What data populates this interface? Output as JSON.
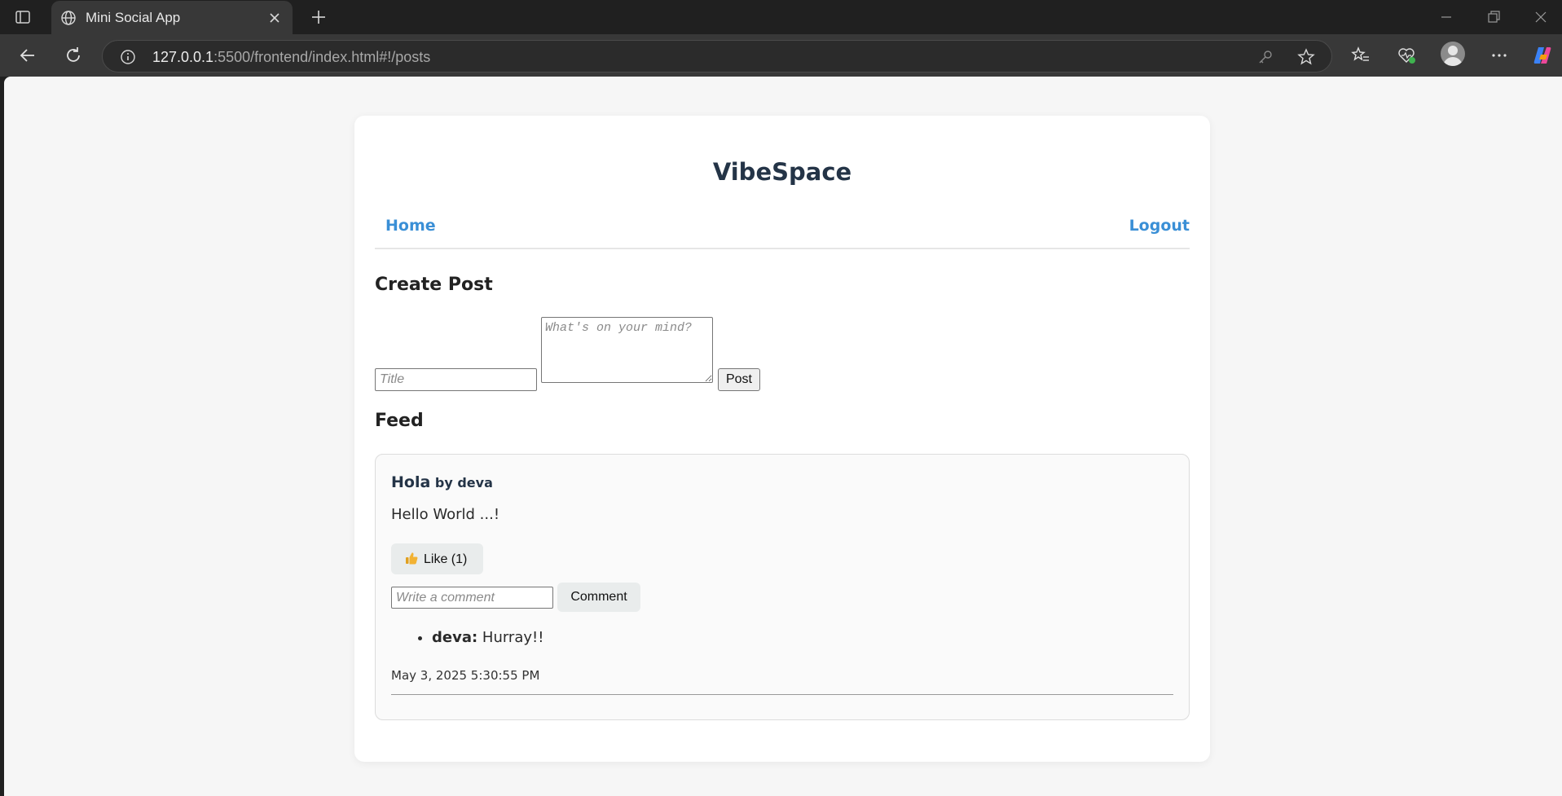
{
  "browser": {
    "tab_title": "Mini Social App",
    "url_host": "127.0.0.1",
    "url_rest": ":5500/frontend/index.html#!/posts"
  },
  "app": {
    "brand": "VibeSpace",
    "nav": {
      "home": "Home",
      "logout": "Logout"
    }
  },
  "create_post": {
    "heading": "Create Post",
    "title_placeholder": "Title",
    "body_placeholder": "What's on your mind?",
    "post_label": "Post"
  },
  "feed": {
    "heading": "Feed",
    "posts": [
      {
        "title": "Hola",
        "byline": "by deva",
        "body": "Hello World ...!",
        "like_label": "Like (1)",
        "comment_placeholder": "Write a comment",
        "comment_button": "Comment",
        "comments": [
          {
            "author": "deva:",
            "text": "Hurray!!"
          }
        ],
        "timestamp": "May 3, 2025 5:30:55 PM"
      }
    ]
  },
  "icons": {
    "thumb": "thumbs-up-icon",
    "like_emoji_color": "#f2b233"
  },
  "colors": {
    "brand": "#243447",
    "link": "#3a8fd6"
  }
}
